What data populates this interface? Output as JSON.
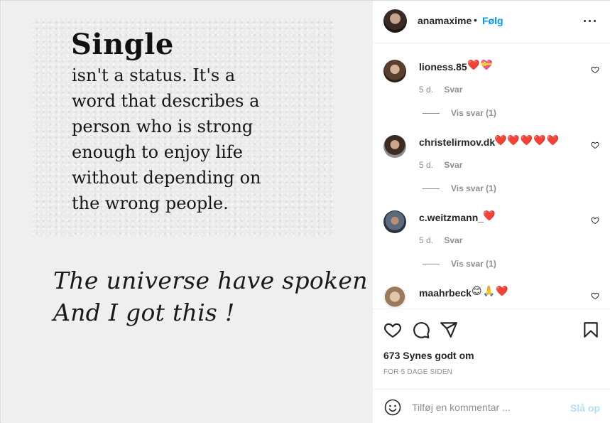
{
  "post": {
    "quote_title": "Single",
    "quote_lines": [
      "isn't a status. It's a",
      "word that describes a",
      "person who is strong",
      "enough to enjoy life",
      "without depending on",
      "the wrong people."
    ],
    "caption_lines": [
      "The universe have spoken",
      "And I got this !"
    ]
  },
  "header": {
    "username": "anamaxime",
    "separator": "•",
    "follow_label": "Følg",
    "avatar_icon": "profile-avatar",
    "more_icon": "more-options-icon"
  },
  "comments": [
    {
      "username": "lioness.85",
      "emoji": "❤️💝",
      "age": "5 d.",
      "reply_label": "Svar",
      "view_replies": "Vis svar (1)"
    },
    {
      "username": "christelirmov.dk",
      "emoji": "❤️❤️❤️❤️❤️",
      "age": "5 d.",
      "reply_label": "Svar",
      "view_replies": "Vis svar (1)"
    },
    {
      "username": "c.weitzmann_",
      "emoji": "❤️",
      "age": "5 d.",
      "reply_label": "Svar",
      "view_replies": "Vis svar (1)"
    },
    {
      "username": "maahrbeck",
      "emoji": "😊🙏❤️",
      "age": "",
      "reply_label": "",
      "view_replies": ""
    }
  ],
  "actions": {
    "like_icon": "heart-icon",
    "comment_icon": "comment-icon",
    "share_icon": "share-icon",
    "save_icon": "bookmark-icon",
    "likes_text": "673 Synes godt om",
    "time_text": "FOR 5 DAGE SIDEN"
  },
  "add_comment": {
    "emoji_icon": "smiley-icon",
    "placeholder": "Tilføj en kommentar ...",
    "post_label": "Slå op"
  },
  "colors": {
    "accent": "#0095f6",
    "post_disabled": "#b2dffc",
    "muted": "#8e8e8e",
    "heart": "#ed4956"
  }
}
